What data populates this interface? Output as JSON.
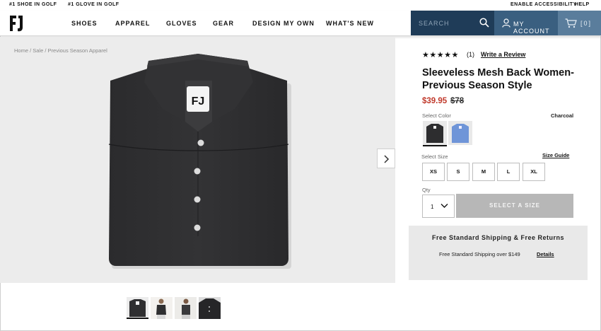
{
  "promo": {
    "left1": "#1 SHOE IN GOLF",
    "left2": "#1 GLOVE IN GOLF"
  },
  "utility": {
    "accessibility": "ENABLE ACCESSIBILITY",
    "help": "HELP"
  },
  "brand": {
    "logo_text": "FJ"
  },
  "nav": {
    "items": [
      "SHOES",
      "APPAREL",
      "GLOVES",
      "GEAR",
      "DESIGN MY OWN",
      "WHAT'S NEW"
    ]
  },
  "search": {
    "placeholder": "SEARCH"
  },
  "account": {
    "label": "MY ACCOUNT"
  },
  "cart": {
    "label": "[0]"
  },
  "breadcrumb": "Home / Sale / Previous Season Apparel",
  "product": {
    "stars": "★★★★★",
    "review_count": "(1)",
    "write_review": "Write a Review",
    "title": "Sleeveless Mesh Back Women-Previous Season Style",
    "price_sale": "$39.95",
    "price_original": "$78",
    "select_color_label": "Select Color",
    "color_name": "Charcoal",
    "swatches": [
      "charcoal",
      "blue"
    ],
    "select_size_label": "Select Size",
    "size_guide": "Size Guide",
    "sizes": [
      "XS",
      "S",
      "M",
      "L",
      "XL"
    ],
    "qty_label": "Qty",
    "qty_value": "1",
    "cta": "SELECT A SIZE"
  },
  "shipping": {
    "title": "Free Standard Shipping & Free Returns",
    "subtitle": "Free Standard Shipping over $149",
    "details": "Details"
  },
  "colors": {
    "search_bg": "#1f3c58",
    "account_bg": "#3a5f80",
    "cart_bg": "#5a7d9c",
    "sale_price": "#c0392b",
    "cta_disabled": "#b7b7b7"
  }
}
